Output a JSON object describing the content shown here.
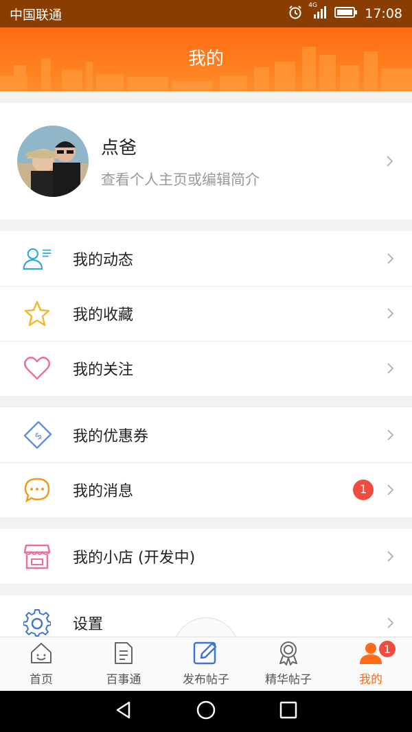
{
  "status_bar": {
    "carrier": "中国联通",
    "network": "4G",
    "time": "17:08",
    "icons": [
      "alarm-icon",
      "signal-icon",
      "battery-icon"
    ]
  },
  "header": {
    "title": "我的"
  },
  "profile": {
    "name": "点爸",
    "subtitle": "查看个人主页或编辑简介"
  },
  "menu_groups": [
    [
      {
        "label": "我的动态",
        "icon": "user-feed-icon"
      },
      {
        "label": "我的收藏",
        "icon": "star-icon"
      },
      {
        "label": "我的关注",
        "icon": "heart-icon"
      }
    ],
    [
      {
        "label": "我的优惠券",
        "icon": "coupon-icon"
      },
      {
        "label": "我的消息",
        "icon": "message-icon",
        "badge": "1"
      }
    ],
    [
      {
        "label": "我的小店 (开发中)",
        "icon": "shop-icon"
      }
    ],
    [
      {
        "label": "设置",
        "icon": "gear-icon"
      }
    ]
  ],
  "tabbar": {
    "items": [
      {
        "label": "首页",
        "icon": "home-icon"
      },
      {
        "label": "百事通",
        "icon": "document-icon"
      },
      {
        "label": "发布帖子",
        "icon": "edit-icon"
      },
      {
        "label": "精华帖子",
        "icon": "award-icon"
      },
      {
        "label": "我的",
        "icon": "person-icon",
        "badge": "1",
        "active": true
      }
    ]
  },
  "colors": {
    "accent": "#ff6a14",
    "status_bar": "#8a3d00",
    "badge": "#ef4b3f",
    "icon_blue": "#2ea7e0",
    "icon_star": "#f5b829",
    "icon_heart": "#ee6f9b",
    "icon_coupon": "#5f8ee6",
    "icon_message": "#f39a1a",
    "icon_shop": "#ee6f9b",
    "icon_gear": "#3d74d8"
  }
}
